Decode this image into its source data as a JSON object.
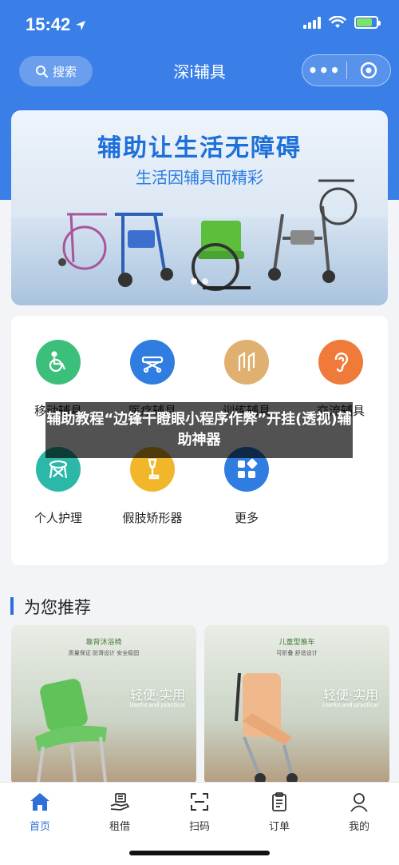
{
  "status_bar": {
    "time": "15:42",
    "battery_level": 0.8
  },
  "navbar": {
    "search_label": "搜索",
    "title": "深i辅具",
    "more_icon": "more-dots-icon",
    "close_icon": "target-circle-icon"
  },
  "banner": {
    "title": "辅助让生活无障碍",
    "subtitle": "生活因辅具而精彩",
    "slide_count": 2,
    "active_slide": 0
  },
  "categories": [
    {
      "label": "移动辅具",
      "icon": "wheelchair-icon",
      "color": "#3dbf7c"
    },
    {
      "label": "医疗辅具",
      "icon": "stretcher-icon",
      "color": "#2f7de0"
    },
    {
      "label": "训练辅具",
      "icon": "parallel-bars-icon",
      "color": "#e0b070"
    },
    {
      "label": "交流辅具",
      "icon": "ear-icon",
      "color": "#f07a3a"
    },
    {
      "label": "个人护理",
      "icon": "shower-chair-icon",
      "color": "#2bb8a8"
    },
    {
      "label": "假肢矫形器",
      "icon": "prosthetic-leg-icon",
      "color": "#f2b62a"
    },
    {
      "label": "更多",
      "icon": "grid-more-icon",
      "color": "#2f7de0"
    }
  ],
  "overlay": {
    "text": "辅助教程“边锋干瞪眼小程序作弊”开挂(透视)辅助神器"
  },
  "recommend": {
    "title": "为您推荐",
    "products": [
      {
        "name": "靠背沐浴椅",
        "tags": "质量保证  防滑设计  安全稳固",
        "slogan": "轻便·实用",
        "slogan_en": "Useful and practical"
      },
      {
        "name": "儿童型推车",
        "tags": "可折叠  舒适设计",
        "slogan": "轻便·实用",
        "slogan_en": "Useful and practical"
      }
    ]
  },
  "tabbar": [
    {
      "label": "首页",
      "icon": "home-icon",
      "active": true
    },
    {
      "label": "租借",
      "icon": "hand-rent-icon",
      "active": false
    },
    {
      "label": "扫码",
      "icon": "scan-icon",
      "active": false
    },
    {
      "label": "订单",
      "icon": "clipboard-icon",
      "active": false
    },
    {
      "label": "我的",
      "icon": "user-icon",
      "active": false
    }
  ],
  "colors": {
    "brand_blue": "#3a7fe8",
    "tab_active": "#2f6fd9"
  }
}
